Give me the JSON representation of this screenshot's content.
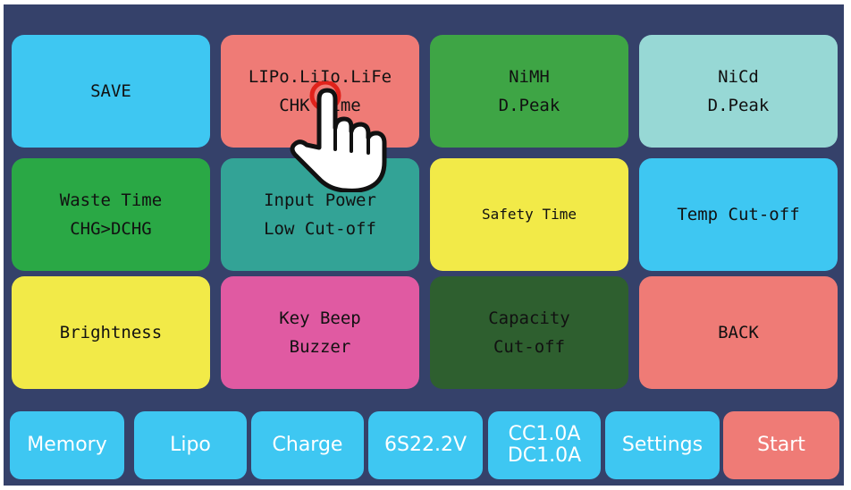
{
  "menu": {
    "save": "SAVE",
    "lipo_chk_line1": "LIPo.LiIo.LiFe",
    "lipo_chk_line2": "CHK Time",
    "nimh_line1": "NiMH",
    "nimh_line2": "D.Peak",
    "nicd_line1": "NiCd",
    "nicd_line2": "D.Peak",
    "waste_line1": "Waste Time",
    "waste_line2": "CHG>DCHG",
    "input_line1": "Input Power",
    "input_line2": "Low Cut-off",
    "safety": "Safety Time",
    "temp": "Temp Cut-off",
    "brightness": "Brightness",
    "beep_line1": "Key Beep",
    "beep_line2": "Buzzer",
    "capacity_line1": "Capacity",
    "capacity_line2": "Cut-off",
    "back": "BACK"
  },
  "bottom_bar": {
    "memory": "Memory",
    "lipo": "Lipo",
    "charge": "Charge",
    "voltage": "6S22.2V",
    "current_line1": "CC1.0A",
    "current_line2": "DC1.0A",
    "settings": "Settings",
    "start": "Start"
  },
  "colors": {
    "background": "#35416a",
    "blue": "#3ec7f2",
    "salmon": "#ef7b76",
    "green": "#3ea545",
    "light_teal": "#97d8d5",
    "bright_green": "#2aa845",
    "teal": "#33a396",
    "yellow": "#f2ea48",
    "pink": "#e05aa2",
    "dark_green": "#2e5f2f",
    "bar_blue": "#3ec7f2",
    "bar_start": "#ef7b76"
  },
  "icons": {
    "pointer": "hand-pointer-icon"
  }
}
